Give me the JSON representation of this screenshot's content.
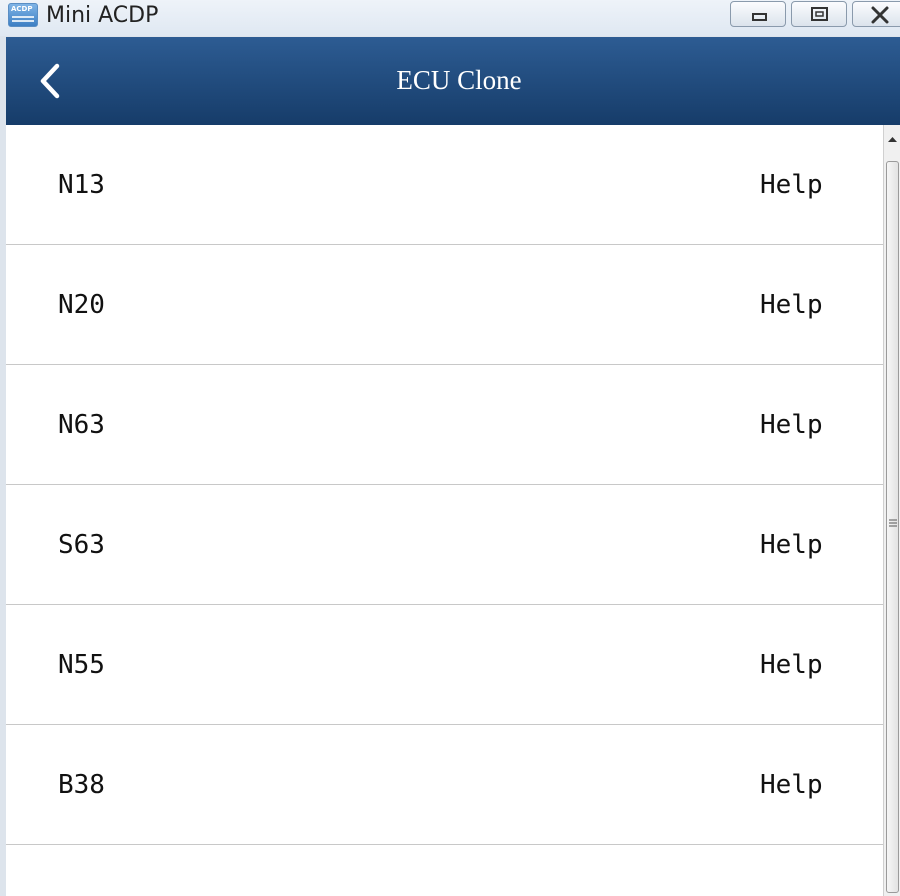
{
  "window": {
    "title": "Mini ACDP",
    "icon_label": "ACDP"
  },
  "header": {
    "title": "ECU Clone"
  },
  "list": {
    "items": [
      {
        "label": "N13",
        "help": "Help"
      },
      {
        "label": "N20",
        "help": "Help"
      },
      {
        "label": "N63",
        "help": "Help"
      },
      {
        "label": "S63",
        "help": "Help"
      },
      {
        "label": "N55",
        "help": "Help"
      },
      {
        "label": "B38",
        "help": "Help"
      }
    ]
  },
  "colors": {
    "header_top": "#2d5c93",
    "header_bottom": "#163c69",
    "list_background": "#ffffff",
    "divider": "#c8c8c8"
  },
  "icons": {
    "back": "chevron-left-icon",
    "minimize": "minimize-icon",
    "maximize": "maximize-icon",
    "close": "close-icon"
  }
}
